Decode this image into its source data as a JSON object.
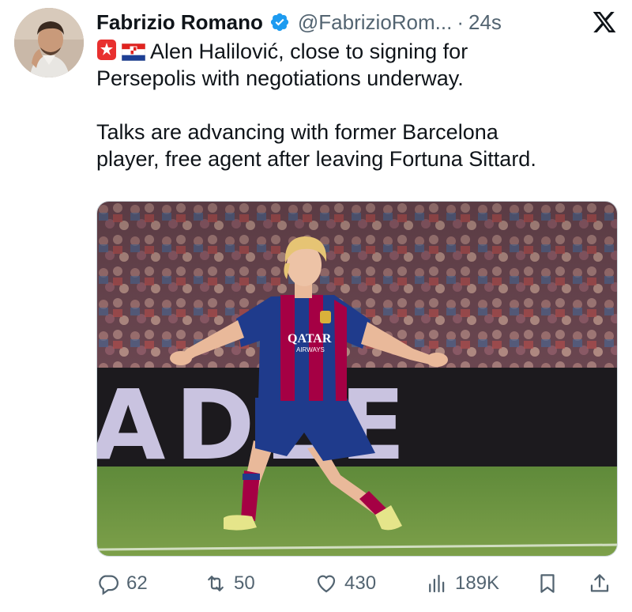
{
  "author": {
    "name": "Fabrizio Romano",
    "handle": "@FabrizioRom...",
    "separator": "·",
    "time": "24s"
  },
  "post": {
    "line1": "Alen Halilović, close to signing for",
    "line2": "Persepolis with negotiations underway.",
    "line3": "Talks are advancing with former Barcelona",
    "line4": "player, free agent after leaving Fortuna Sittard."
  },
  "media": {
    "banner_text": "ADEE",
    "shirt_sponsor": "QATAR",
    "shirt_sponsor_sub": "AIRWAYS"
  },
  "actions": {
    "replies": "62",
    "reposts": "50",
    "likes": "430",
    "views": "189K"
  },
  "colors": {
    "verified_blue": "#1d9bf0",
    "muted_text": "#536471",
    "shirt_red": "#a50044",
    "shirt_blue": "#1f3b8c"
  }
}
